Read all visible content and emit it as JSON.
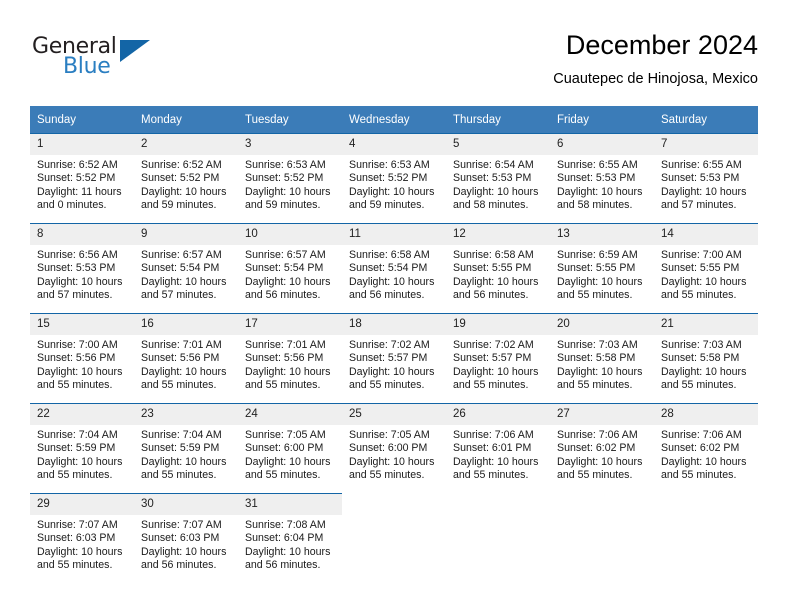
{
  "logo": {
    "primary_text": "General",
    "secondary_text": "Blue",
    "primary_color": "#231f20",
    "secondary_color": "#2a7ec1",
    "triangle_color": "#1365a6",
    "triangle_icon": "triangle-icon"
  },
  "header": {
    "title": "December 2024",
    "subtitle": "Cuautepec de Hinojosa, Mexico"
  },
  "theme": {
    "header_bg": "#3b7cb8",
    "row_divider": "#1365a6",
    "daynum_bg": "#efefef",
    "page_bg": "#ffffff"
  },
  "weekdays": [
    "Sunday",
    "Monday",
    "Tuesday",
    "Wednesday",
    "Thursday",
    "Friday",
    "Saturday"
  ],
  "weeks": [
    [
      {
        "day": "1",
        "sunrise": "Sunrise: 6:52 AM",
        "sunset": "Sunset: 5:52 PM",
        "daylight_line1": "Daylight: 11 hours",
        "daylight_line2": "and 0 minutes."
      },
      {
        "day": "2",
        "sunrise": "Sunrise: 6:52 AM",
        "sunset": "Sunset: 5:52 PM",
        "daylight_line1": "Daylight: 10 hours",
        "daylight_line2": "and 59 minutes."
      },
      {
        "day": "3",
        "sunrise": "Sunrise: 6:53 AM",
        "sunset": "Sunset: 5:52 PM",
        "daylight_line1": "Daylight: 10 hours",
        "daylight_line2": "and 59 minutes."
      },
      {
        "day": "4",
        "sunrise": "Sunrise: 6:53 AM",
        "sunset": "Sunset: 5:52 PM",
        "daylight_line1": "Daylight: 10 hours",
        "daylight_line2": "and 59 minutes."
      },
      {
        "day": "5",
        "sunrise": "Sunrise: 6:54 AM",
        "sunset": "Sunset: 5:53 PM",
        "daylight_line1": "Daylight: 10 hours",
        "daylight_line2": "and 58 minutes."
      },
      {
        "day": "6",
        "sunrise": "Sunrise: 6:55 AM",
        "sunset": "Sunset: 5:53 PM",
        "daylight_line1": "Daylight: 10 hours",
        "daylight_line2": "and 58 minutes."
      },
      {
        "day": "7",
        "sunrise": "Sunrise: 6:55 AM",
        "sunset": "Sunset: 5:53 PM",
        "daylight_line1": "Daylight: 10 hours",
        "daylight_line2": "and 57 minutes."
      }
    ],
    [
      {
        "day": "8",
        "sunrise": "Sunrise: 6:56 AM",
        "sunset": "Sunset: 5:53 PM",
        "daylight_line1": "Daylight: 10 hours",
        "daylight_line2": "and 57 minutes."
      },
      {
        "day": "9",
        "sunrise": "Sunrise: 6:57 AM",
        "sunset": "Sunset: 5:54 PM",
        "daylight_line1": "Daylight: 10 hours",
        "daylight_line2": "and 57 minutes."
      },
      {
        "day": "10",
        "sunrise": "Sunrise: 6:57 AM",
        "sunset": "Sunset: 5:54 PM",
        "daylight_line1": "Daylight: 10 hours",
        "daylight_line2": "and 56 minutes."
      },
      {
        "day": "11",
        "sunrise": "Sunrise: 6:58 AM",
        "sunset": "Sunset: 5:54 PM",
        "daylight_line1": "Daylight: 10 hours",
        "daylight_line2": "and 56 minutes."
      },
      {
        "day": "12",
        "sunrise": "Sunrise: 6:58 AM",
        "sunset": "Sunset: 5:55 PM",
        "daylight_line1": "Daylight: 10 hours",
        "daylight_line2": "and 56 minutes."
      },
      {
        "day": "13",
        "sunrise": "Sunrise: 6:59 AM",
        "sunset": "Sunset: 5:55 PM",
        "daylight_line1": "Daylight: 10 hours",
        "daylight_line2": "and 55 minutes."
      },
      {
        "day": "14",
        "sunrise": "Sunrise: 7:00 AM",
        "sunset": "Sunset: 5:55 PM",
        "daylight_line1": "Daylight: 10 hours",
        "daylight_line2": "and 55 minutes."
      }
    ],
    [
      {
        "day": "15",
        "sunrise": "Sunrise: 7:00 AM",
        "sunset": "Sunset: 5:56 PM",
        "daylight_line1": "Daylight: 10 hours",
        "daylight_line2": "and 55 minutes."
      },
      {
        "day": "16",
        "sunrise": "Sunrise: 7:01 AM",
        "sunset": "Sunset: 5:56 PM",
        "daylight_line1": "Daylight: 10 hours",
        "daylight_line2": "and 55 minutes."
      },
      {
        "day": "17",
        "sunrise": "Sunrise: 7:01 AM",
        "sunset": "Sunset: 5:56 PM",
        "daylight_line1": "Daylight: 10 hours",
        "daylight_line2": "and 55 minutes."
      },
      {
        "day": "18",
        "sunrise": "Sunrise: 7:02 AM",
        "sunset": "Sunset: 5:57 PM",
        "daylight_line1": "Daylight: 10 hours",
        "daylight_line2": "and 55 minutes."
      },
      {
        "day": "19",
        "sunrise": "Sunrise: 7:02 AM",
        "sunset": "Sunset: 5:57 PM",
        "daylight_line1": "Daylight: 10 hours",
        "daylight_line2": "and 55 minutes."
      },
      {
        "day": "20",
        "sunrise": "Sunrise: 7:03 AM",
        "sunset": "Sunset: 5:58 PM",
        "daylight_line1": "Daylight: 10 hours",
        "daylight_line2": "and 55 minutes."
      },
      {
        "day": "21",
        "sunrise": "Sunrise: 7:03 AM",
        "sunset": "Sunset: 5:58 PM",
        "daylight_line1": "Daylight: 10 hours",
        "daylight_line2": "and 55 minutes."
      }
    ],
    [
      {
        "day": "22",
        "sunrise": "Sunrise: 7:04 AM",
        "sunset": "Sunset: 5:59 PM",
        "daylight_line1": "Daylight: 10 hours",
        "daylight_line2": "and 55 minutes."
      },
      {
        "day": "23",
        "sunrise": "Sunrise: 7:04 AM",
        "sunset": "Sunset: 5:59 PM",
        "daylight_line1": "Daylight: 10 hours",
        "daylight_line2": "and 55 minutes."
      },
      {
        "day": "24",
        "sunrise": "Sunrise: 7:05 AM",
        "sunset": "Sunset: 6:00 PM",
        "daylight_line1": "Daylight: 10 hours",
        "daylight_line2": "and 55 minutes."
      },
      {
        "day": "25",
        "sunrise": "Sunrise: 7:05 AM",
        "sunset": "Sunset: 6:00 PM",
        "daylight_line1": "Daylight: 10 hours",
        "daylight_line2": "and 55 minutes."
      },
      {
        "day": "26",
        "sunrise": "Sunrise: 7:06 AM",
        "sunset": "Sunset: 6:01 PM",
        "daylight_line1": "Daylight: 10 hours",
        "daylight_line2": "and 55 minutes."
      },
      {
        "day": "27",
        "sunrise": "Sunrise: 7:06 AM",
        "sunset": "Sunset: 6:02 PM",
        "daylight_line1": "Daylight: 10 hours",
        "daylight_line2": "and 55 minutes."
      },
      {
        "day": "28",
        "sunrise": "Sunrise: 7:06 AM",
        "sunset": "Sunset: 6:02 PM",
        "daylight_line1": "Daylight: 10 hours",
        "daylight_line2": "and 55 minutes."
      }
    ],
    [
      {
        "day": "29",
        "sunrise": "Sunrise: 7:07 AM",
        "sunset": "Sunset: 6:03 PM",
        "daylight_line1": "Daylight: 10 hours",
        "daylight_line2": "and 55 minutes."
      },
      {
        "day": "30",
        "sunrise": "Sunrise: 7:07 AM",
        "sunset": "Sunset: 6:03 PM",
        "daylight_line1": "Daylight: 10 hours",
        "daylight_line2": "and 56 minutes."
      },
      {
        "day": "31",
        "sunrise": "Sunrise: 7:08 AM",
        "sunset": "Sunset: 6:04 PM",
        "daylight_line1": "Daylight: 10 hours",
        "daylight_line2": "and 56 minutes."
      },
      null,
      null,
      null,
      null
    ]
  ]
}
